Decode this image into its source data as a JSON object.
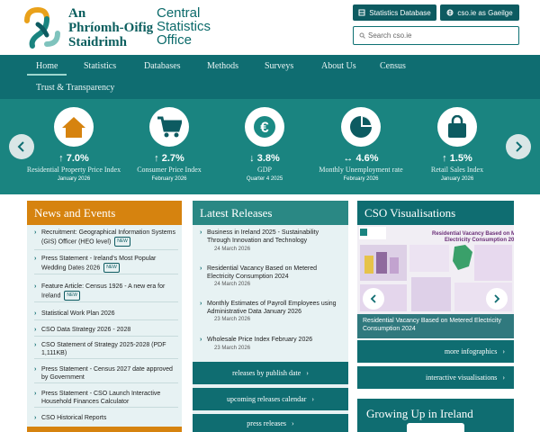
{
  "header": {
    "brand_ga_line1": "An",
    "brand_ga_line2": "Phríomh-Oifig",
    "brand_ga_line3": "Staidrimh",
    "brand_en_line1": "Central",
    "brand_en_line2": "Statistics",
    "brand_en_line3": "Office",
    "btn_database": "Statistics Database",
    "btn_gaeilge": "cso.ie as Gaeilge",
    "search_placeholder": "Search cso.ie"
  },
  "nav": {
    "items": [
      "Home",
      "Statistics",
      "Databases",
      "Methods",
      "Surveys",
      "About Us",
      "Census"
    ],
    "item2": "Trust & Transparency",
    "active": "Home"
  },
  "stats": [
    {
      "icon": "house-icon",
      "value": "↑ 7.0%",
      "label": "Residential Property Price Index",
      "date": "January 2026"
    },
    {
      "icon": "cart-icon",
      "value": "↑ 2.7%",
      "label": "Consumer Price Index",
      "date": "February 2026"
    },
    {
      "icon": "euro-icon",
      "value": "↓ 3.8%",
      "label": "GDP",
      "date": "Quarter 4 2025"
    },
    {
      "icon": "pie-chart-icon",
      "value": "↔ 4.6%",
      "label": "Monthly Unemployment rate",
      "date": "February 2026"
    },
    {
      "icon": "shopping-bag-icon",
      "value": "↑ 1.5%",
      "label": "Retail Sales Index",
      "date": "January 2026"
    }
  ],
  "news": {
    "title": "News and Events",
    "items": [
      {
        "text": "Recruitment: Geographical Information Systems (GIS) Officer (HEO level)",
        "badge": "NEW"
      },
      {
        "text": "Press Statement - Ireland's Most Popular Wedding Dates 2026",
        "badge": "NEW"
      },
      {
        "text": "Feature Article: Census 1926 - A new era for Ireland",
        "badge": "NEW"
      },
      {
        "text": "Statistical Work Plan 2026",
        "badge": ""
      },
      {
        "text": "CSO Data Strategy 2026 - 2028",
        "badge": ""
      },
      {
        "text": "CSO Statement of Strategy 2025-2028 (PDF 1,111KB)",
        "badge": ""
      },
      {
        "text": "Press Statement - Census 2027 date approved by Government",
        "badge": ""
      },
      {
        "text": "Press Statement - CSO Launch Interactive Household Finances Calculator",
        "badge": ""
      },
      {
        "text": "CSO Historical Reports",
        "badge": ""
      }
    ]
  },
  "releases": {
    "title": "Latest Releases",
    "items": [
      {
        "text": "Business in Ireland 2025 - Sustainability Through Innovation and Technology",
        "date": "24 March 2026"
      },
      {
        "text": "Residential Vacancy Based on Metered Electricity Consumption 2024",
        "date": "24 March 2026"
      },
      {
        "text": "Monthly Estimates of Payroll Employees using Administrative Data January 2026",
        "date": "23 March 2026"
      },
      {
        "text": "Wholesale Price Index February 2026",
        "date": "23 March 2026"
      }
    ],
    "link1": "releases by publish date",
    "link2": "upcoming releases calendar",
    "link3": "press releases"
  },
  "viz": {
    "title": "CSO Visualisations",
    "slide_title": "Residential Vacancy Based on Metered Electricity Consumption 2024",
    "caption": "Residential Vacancy Based on Metered Electricity Consumption 2024",
    "link1": "more infographics",
    "link2": "interactive visualisations",
    "growing": "Growing Up in Ireland"
  },
  "colors": {
    "teal_dark": "#0f6d71",
    "teal_band": "#1a8480",
    "news_header": "#d6830f",
    "panel_bg": "#e7f2f3"
  }
}
